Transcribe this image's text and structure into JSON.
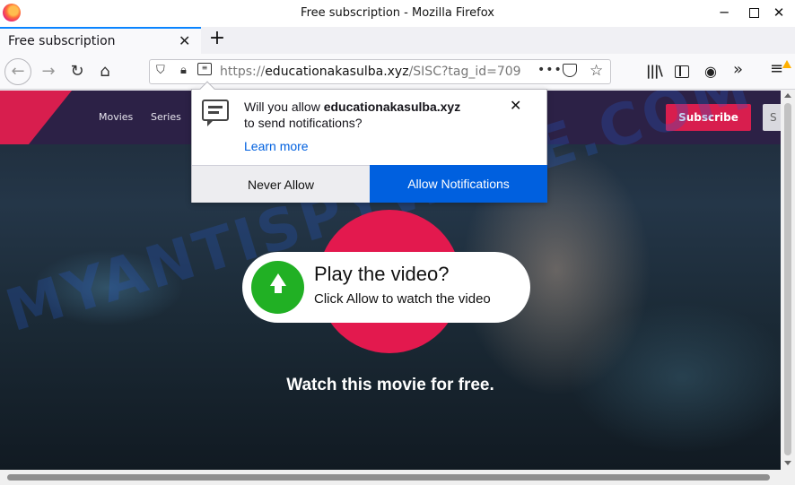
{
  "window": {
    "title": "Free subscription - Mozilla Firefox",
    "minimize": "─",
    "close": "✕"
  },
  "tab": {
    "title": "Free subscription",
    "close": "✕",
    "new_tab": "+"
  },
  "navbar": {
    "back": "←",
    "forward": "→",
    "reload": "↻",
    "home": "⌂",
    "url_protocol": "https://",
    "url_domain": "educationakasulba.xyz",
    "url_path": "/SISC?tag_id=709",
    "page_actions": "•••",
    "bookmark": "☆",
    "library": "|||\\",
    "account": "◉",
    "overflow": "»",
    "menu": "≡"
  },
  "site": {
    "nav": [
      "Movies",
      "Series"
    ],
    "subscribe": "Subscribe",
    "signin": "S",
    "watermark": "MYANTISPYWARE.COM",
    "play_title": "Play the video?",
    "play_subtitle": "Click Allow to watch the video",
    "watch_text": "Watch this movie for free."
  },
  "popup": {
    "text_prefix": "Will you allow ",
    "domain": "educationakasulba.xyz",
    "text_suffix": "to send notifications?",
    "learn_more": "Learn more",
    "close": "✕",
    "never_allow": "Never Allow",
    "allow": "Allow Notifications"
  },
  "colors": {
    "accent_blue": "#0060df",
    "site_red": "#d81e4e",
    "header_purple": "#2c2146",
    "play_green": "#21b024"
  }
}
